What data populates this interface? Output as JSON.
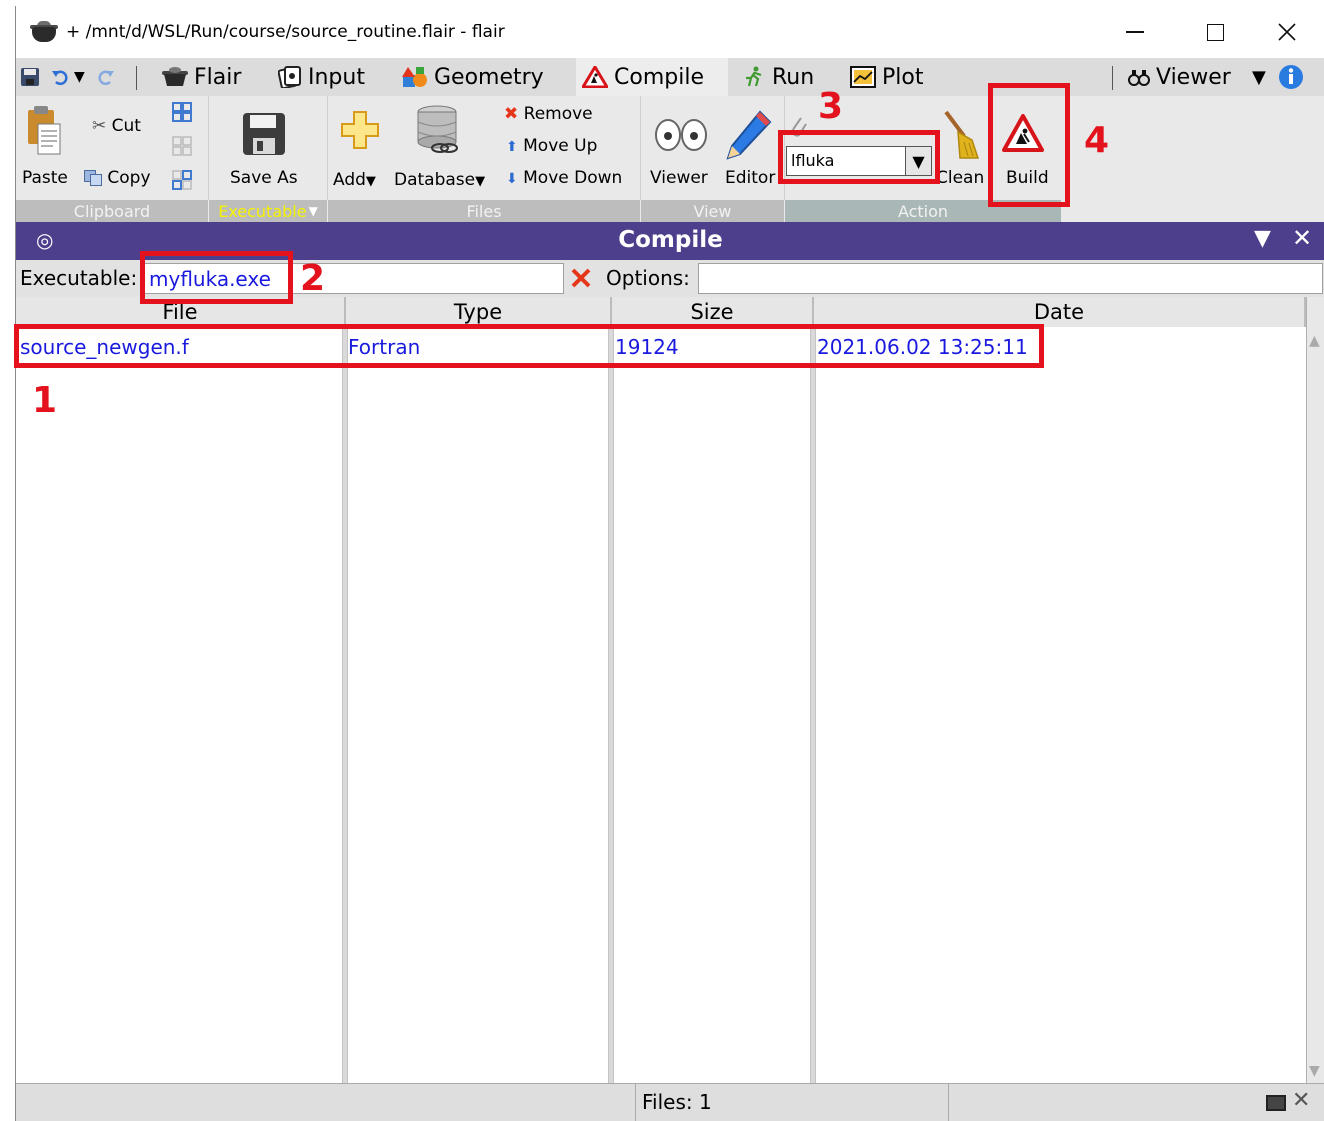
{
  "window": {
    "title": "+ /mnt/d/WSL/Run/course/source_routine.flair - flair"
  },
  "tabs": {
    "flair": "Flair",
    "input": "Input",
    "geometry": "Geometry",
    "compile": "Compile",
    "run": "Run",
    "plot": "Plot",
    "viewer": "Viewer"
  },
  "ribbon": {
    "paste": "Paste",
    "cut": "Cut",
    "copy": "Copy",
    "save_as": "Save As",
    "add": "Add",
    "database": "Database",
    "remove": "Remove",
    "move_up": "Move Up",
    "move_down": "Move Down",
    "viewer": "Viewer",
    "editor": "Editor",
    "linker_value": "lfluka",
    "clean": "Clean",
    "build": "Build",
    "groups": {
      "clipboard": "Clipboard",
      "executable": "Executable",
      "files": "Files",
      "view": "View",
      "action": "Action"
    }
  },
  "panel": {
    "title": "Compile",
    "executable_label": "Executable:",
    "executable_value": "myfluka.exe",
    "options_label": "Options:",
    "options_value": ""
  },
  "table": {
    "headers": [
      "File",
      "Type",
      "Size",
      "Date"
    ],
    "rows": [
      {
        "file": "source_newgen.f",
        "type": "Fortran",
        "size": "19124",
        "date": "2021.06.02 13:25:11"
      }
    ]
  },
  "status": {
    "text": "Files: 1"
  },
  "annotations": [
    "1",
    "2",
    "3",
    "4"
  ],
  "colors": {
    "annotation": "#e3121d",
    "panel_header": "#4e3f8c",
    "link_text": "#1a1adf",
    "executable_group_label": "#f5f200"
  }
}
